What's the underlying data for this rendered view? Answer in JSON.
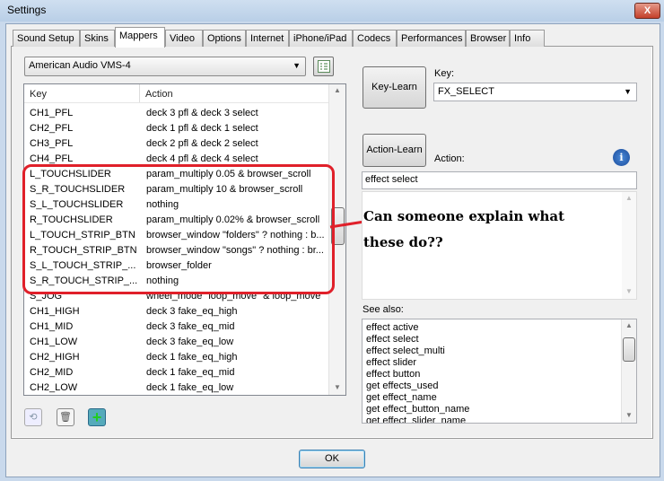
{
  "window": {
    "title": "Settings",
    "close": "X"
  },
  "tabs": [
    "Sound Setup",
    "Skins",
    "Mappers",
    "Video",
    "Options",
    "Internet",
    "iPhone/iPad",
    "Codecs",
    "Performances",
    "Browser",
    "Info"
  ],
  "mapper": {
    "selected": "American Audio VMS-4"
  },
  "table": {
    "headers": [
      "Key",
      "Action"
    ],
    "rows": [
      [
        "CH1_PFL",
        "deck 3 pfl & deck 3 select"
      ],
      [
        "CH2_PFL",
        "deck 1 pfl & deck 1 select"
      ],
      [
        "CH3_PFL",
        "deck 2 pfl & deck 2 select"
      ],
      [
        "CH4_PFL",
        "deck 4 pfl & deck 4 select"
      ],
      [
        "L_TOUCHSLIDER",
        "param_multiply 0.05 & browser_scroll"
      ],
      [
        "S_R_TOUCHSLIDER",
        "param_multiply 10 & browser_scroll"
      ],
      [
        "S_L_TOUCHSLIDER",
        "nothing"
      ],
      [
        "R_TOUCHSLIDER",
        "param_multiply 0.02% & browser_scroll"
      ],
      [
        "L_TOUCH_STRIP_BTN",
        "browser_window \"folders\" ? nothing : b..."
      ],
      [
        "R_TOUCH_STRIP_BTN",
        "browser_window \"songs\" ? nothing : br..."
      ],
      [
        "S_L_TOUCH_STRIP_...",
        "browser_folder"
      ],
      [
        "S_R_TOUCH_STRIP_...",
        "nothing"
      ],
      [
        "S_JOG",
        "wheel_mode \"loop_move\" & loop_move"
      ],
      [
        "CH1_HIGH",
        "deck 3 fake_eq_high"
      ],
      [
        "CH1_MID",
        "deck 3 fake_eq_mid"
      ],
      [
        "CH1_LOW",
        "deck 3 fake_eq_low"
      ],
      [
        "CH2_HIGH",
        "deck 1 fake_eq_high"
      ],
      [
        "CH2_MID",
        "deck 1 fake_eq_mid"
      ],
      [
        "CH2_LOW",
        "deck 1 fake_eq_low"
      ]
    ]
  },
  "annotation": {
    "line1": "Can someone explain what",
    "line2": "these do??",
    "color": "#e0202a"
  },
  "right": {
    "key_learn": "Key-Learn",
    "key_label": "Key:",
    "key_value": "FX_SELECT",
    "action_learn": "Action-Learn",
    "action_label": "Action:",
    "action_value": "effect select",
    "see_also_label": "See also:",
    "see_also": [
      "effect active",
      "effect select",
      "effect select_multi",
      "effect slider",
      "effect button",
      "get effects_used",
      "get effect_name",
      "get effect_button_name",
      "get effect_slider_name"
    ]
  },
  "ok": "OK"
}
